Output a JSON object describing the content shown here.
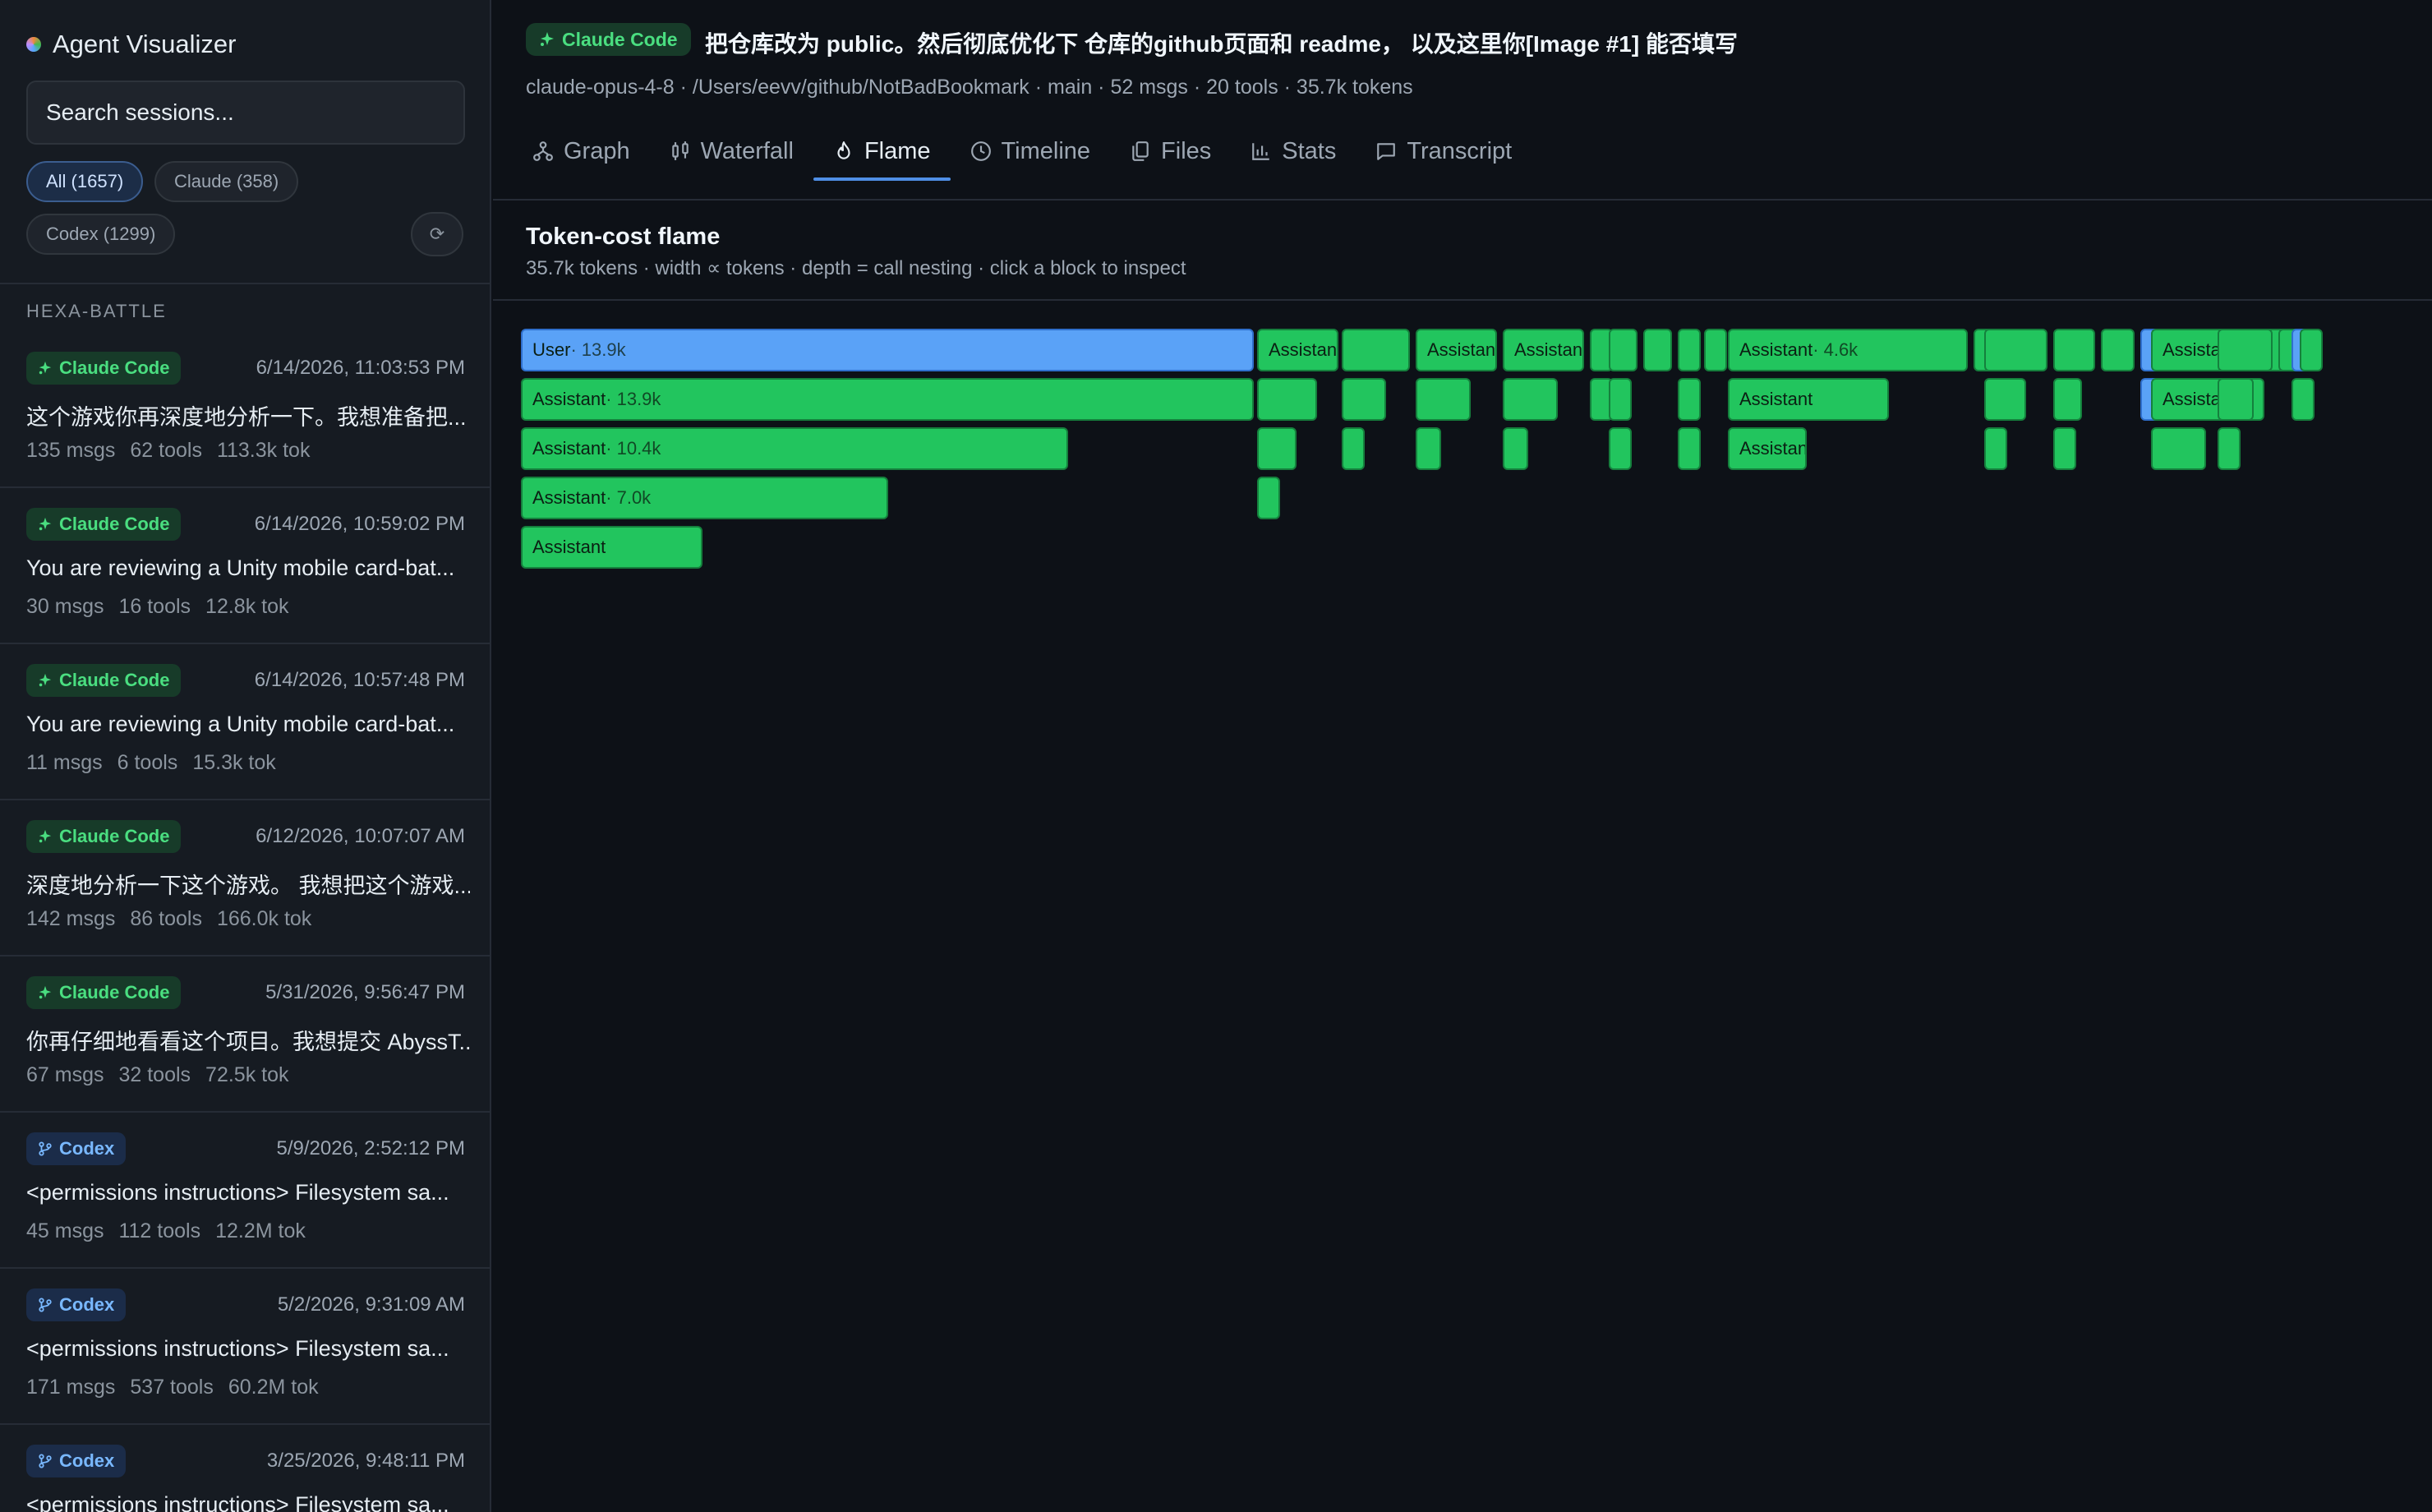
{
  "sidebar": {
    "app_title": "Agent Visualizer",
    "search_placeholder": "Search sessions...",
    "filters": {
      "all": "All (1657)",
      "claude": "Claude (358)",
      "codex": "Codex (1299)"
    },
    "refresh_icon": "refresh-icon",
    "group_title": "HEXA-BATTLE",
    "sessions": [
      {
        "badge": "Claude Code",
        "kind": "claude",
        "date": "6/14/2026, 11:03:53 PM",
        "title": "这个游戏你再深度地分析一下。我想准备把...",
        "msgs": "135 msgs",
        "tools": "62 tools",
        "tok": "113.3k tok"
      },
      {
        "badge": "Claude Code",
        "kind": "claude",
        "date": "6/14/2026, 10:59:02 PM",
        "title": "You are reviewing a Unity mobile card-bat...",
        "msgs": "30 msgs",
        "tools": "16 tools",
        "tok": "12.8k tok"
      },
      {
        "badge": "Claude Code",
        "kind": "claude",
        "date": "6/14/2026, 10:57:48 PM",
        "title": "You are reviewing a Unity mobile card-bat...",
        "msgs": "11 msgs",
        "tools": "6 tools",
        "tok": "15.3k tok"
      },
      {
        "badge": "Claude Code",
        "kind": "claude",
        "date": "6/12/2026, 10:07:07 AM",
        "title": "深度地分析一下这个游戏。 我想把这个游戏...",
        "msgs": "142 msgs",
        "tools": "86 tools",
        "tok": "166.0k tok"
      },
      {
        "badge": "Claude Code",
        "kind": "claude",
        "date": "5/31/2026, 9:56:47 PM",
        "title": "你再仔细地看看这个项目。我想提交 AbyssT...",
        "msgs": "67 msgs",
        "tools": "32 tools",
        "tok": "72.5k tok"
      },
      {
        "badge": "Codex",
        "kind": "codex",
        "date": "5/9/2026, 2:52:12 PM",
        "title": "<permissions instructions> Filesystem sa...",
        "msgs": "45 msgs",
        "tools": "112 tools",
        "tok": "12.2M tok"
      },
      {
        "badge": "Codex",
        "kind": "codex",
        "date": "5/2/2026, 9:31:09 AM",
        "title": "<permissions instructions> Filesystem sa...",
        "msgs": "171 msgs",
        "tools": "537 tools",
        "tok": "60.2M tok"
      },
      {
        "badge": "Codex",
        "kind": "codex",
        "date": "3/25/2026, 9:48:11 PM",
        "title": "<permissions instructions> Filesystem sa...",
        "msgs": "",
        "tools": "",
        "tok": ""
      }
    ]
  },
  "header": {
    "badge": "Claude Code",
    "title": "把仓库改为 public。然后彻底优化下 仓库的github页面和 readme， 以及这里你[Image #1] 能否填写",
    "model": "claude-opus-4-8",
    "path": "/Users/eevv/github/NotBadBookmark",
    "branch": "main",
    "msgs": "52 msgs",
    "tools": "20 tools",
    "tokens": "35.7k tokens",
    "separator": " · "
  },
  "tabs": [
    {
      "label": "Graph",
      "icon": "graph-icon"
    },
    {
      "label": "Waterfall",
      "icon": "waterfall-icon"
    },
    {
      "label": "Flame",
      "icon": "flame-icon",
      "active": true
    },
    {
      "label": "Timeline",
      "icon": "clock-icon"
    },
    {
      "label": "Files",
      "icon": "files-icon"
    },
    {
      "label": "Stats",
      "icon": "bar-chart-icon"
    },
    {
      "label": "Transcript",
      "icon": "chat-icon"
    }
  ],
  "panel": {
    "title": "Token-cost flame",
    "subtitle": "35.7k tokens · width ∝ tokens · depth = call nesting · click a block to inspect"
  },
  "flame": {
    "total_tokens": 35700,
    "colors": {
      "user": "#5aa2f7",
      "assistant": "#22c55e"
    },
    "blocks": [
      {
        "depth": 0,
        "start": 0,
        "tokens": 13900,
        "kind": "user",
        "label": "User",
        "tokens_label": "13.9k"
      },
      {
        "depth": 0,
        "start": 13900,
        "tokens": 1600,
        "kind": "assistant",
        "label": "Assistant"
      },
      {
        "depth": 0,
        "start": 15500,
        "tokens": 1350,
        "kind": "assistant",
        "label": ""
      },
      {
        "depth": 0,
        "start": 16900,
        "tokens": 1600,
        "kind": "assistant",
        "label": "Assistant"
      },
      {
        "depth": 0,
        "start": 18550,
        "tokens": 1600,
        "kind": "assistant",
        "label": "Assistant"
      },
      {
        "depth": 0,
        "start": 20200,
        "tokens": 350,
        "kind": "assistant",
        "label": ""
      },
      {
        "depth": 0,
        "start": 20550,
        "tokens": 600,
        "kind": "assistant",
        "label": ""
      },
      {
        "depth": 0,
        "start": 21200,
        "tokens": 600,
        "kind": "assistant",
        "label": ""
      },
      {
        "depth": 0,
        "start": 21850,
        "tokens": 450,
        "kind": "assistant",
        "label": ""
      },
      {
        "depth": 0,
        "start": 22350,
        "tokens": 400,
        "kind": "assistant",
        "label": ""
      },
      {
        "depth": 0,
        "start": 22800,
        "tokens": 4600,
        "kind": "assistant",
        "label": "Assistant",
        "tokens_label": "4.6k"
      },
      {
        "depth": 0,
        "start": 27450,
        "tokens": 200,
        "kind": "assistant",
        "label": ""
      },
      {
        "depth": 0,
        "start": 27650,
        "tokens": 1250,
        "kind": "assistant",
        "label": ""
      },
      {
        "depth": 0,
        "start": 28950,
        "tokens": 850,
        "kind": "assistant",
        "label": ""
      },
      {
        "depth": 0,
        "start": 29850,
        "tokens": 700,
        "kind": "assistant",
        "label": ""
      },
      {
        "depth": 0,
        "start": 30600,
        "tokens": 200,
        "kind": "user",
        "label": ""
      },
      {
        "depth": 0,
        "start": 30800,
        "tokens": 3200,
        "kind": "assistant",
        "label": "Assistant"
      },
      {
        "depth": 0,
        "start": 32050,
        "tokens": 1100,
        "kind": "assistant",
        "label": ""
      },
      {
        "depth": 0,
        "start": 33200,
        "tokens": 250,
        "kind": "assistant",
        "label": ""
      },
      {
        "depth": 0,
        "start": 33450,
        "tokens": 150,
        "kind": "user",
        "label": ""
      },
      {
        "depth": 0,
        "start": 33600,
        "tokens": 350,
        "kind": "assistant",
        "label": ""
      },
      {
        "depth": 1,
        "start": 0,
        "tokens": 13900,
        "kind": "assistant",
        "label": "Assistant",
        "tokens_label": "13.9k"
      },
      {
        "depth": 1,
        "start": 13900,
        "tokens": 1200,
        "kind": "assistant",
        "label": ""
      },
      {
        "depth": 1,
        "start": 15500,
        "tokens": 900,
        "kind": "assistant",
        "label": ""
      },
      {
        "depth": 1,
        "start": 16900,
        "tokens": 1100,
        "kind": "assistant",
        "label": ""
      },
      {
        "depth": 1,
        "start": 18550,
        "tokens": 1100,
        "kind": "assistant",
        "label": ""
      },
      {
        "depth": 1,
        "start": 20200,
        "tokens": 350,
        "kind": "assistant",
        "label": ""
      },
      {
        "depth": 1,
        "start": 20550,
        "tokens": 350,
        "kind": "assistant",
        "label": ""
      },
      {
        "depth": 1,
        "start": 21850,
        "tokens": 400,
        "kind": "assistant",
        "label": ""
      },
      {
        "depth": 1,
        "start": 22800,
        "tokens": 3100,
        "kind": "assistant",
        "label": "Assistant"
      },
      {
        "depth": 1,
        "start": 27650,
        "tokens": 850,
        "kind": "assistant",
        "label": ""
      },
      {
        "depth": 1,
        "start": 28950,
        "tokens": 600,
        "kind": "assistant",
        "label": ""
      },
      {
        "depth": 1,
        "start": 30600,
        "tokens": 200,
        "kind": "user",
        "label": ""
      },
      {
        "depth": 1,
        "start": 30800,
        "tokens": 2200,
        "kind": "assistant",
        "label": "Assistant"
      },
      {
        "depth": 1,
        "start": 32050,
        "tokens": 750,
        "kind": "assistant",
        "label": ""
      },
      {
        "depth": 1,
        "start": 33450,
        "tokens": 400,
        "kind": "assistant",
        "label": ""
      },
      {
        "depth": 2,
        "start": 0,
        "tokens": 10400,
        "kind": "assistant",
        "label": "Assistant",
        "tokens_label": "10.4k"
      },
      {
        "depth": 2,
        "start": 13900,
        "tokens": 800,
        "kind": "assistant",
        "label": ""
      },
      {
        "depth": 2,
        "start": 15500,
        "tokens": 450,
        "kind": "assistant",
        "label": ""
      },
      {
        "depth": 2,
        "start": 16900,
        "tokens": 550,
        "kind": "assistant",
        "label": ""
      },
      {
        "depth": 2,
        "start": 18550,
        "tokens": 550,
        "kind": "assistant",
        "label": ""
      },
      {
        "depth": 2,
        "start": 20550,
        "tokens": 400,
        "kind": "assistant",
        "label": ""
      },
      {
        "depth": 2,
        "start": 21850,
        "tokens": 400,
        "kind": "assistant",
        "label": ""
      },
      {
        "depth": 2,
        "start": 22800,
        "tokens": 1550,
        "kind": "assistant",
        "label": "Assistant"
      },
      {
        "depth": 2,
        "start": 27650,
        "tokens": 450,
        "kind": "assistant",
        "label": ""
      },
      {
        "depth": 2,
        "start": 28950,
        "tokens": 450,
        "kind": "assistant",
        "label": ""
      },
      {
        "depth": 2,
        "start": 30800,
        "tokens": 1100,
        "kind": "assistant",
        "label": ""
      },
      {
        "depth": 2,
        "start": 32050,
        "tokens": 450,
        "kind": "assistant",
        "label": ""
      },
      {
        "depth": 3,
        "start": 0,
        "tokens": 7000,
        "kind": "assistant",
        "label": "Assistant",
        "tokens_label": "7.0k"
      },
      {
        "depth": 3,
        "start": 13900,
        "tokens": 400,
        "kind": "assistant",
        "label": ""
      },
      {
        "depth": 4,
        "start": 0,
        "tokens": 3500,
        "kind": "assistant",
        "label": "Assistant"
      }
    ]
  }
}
